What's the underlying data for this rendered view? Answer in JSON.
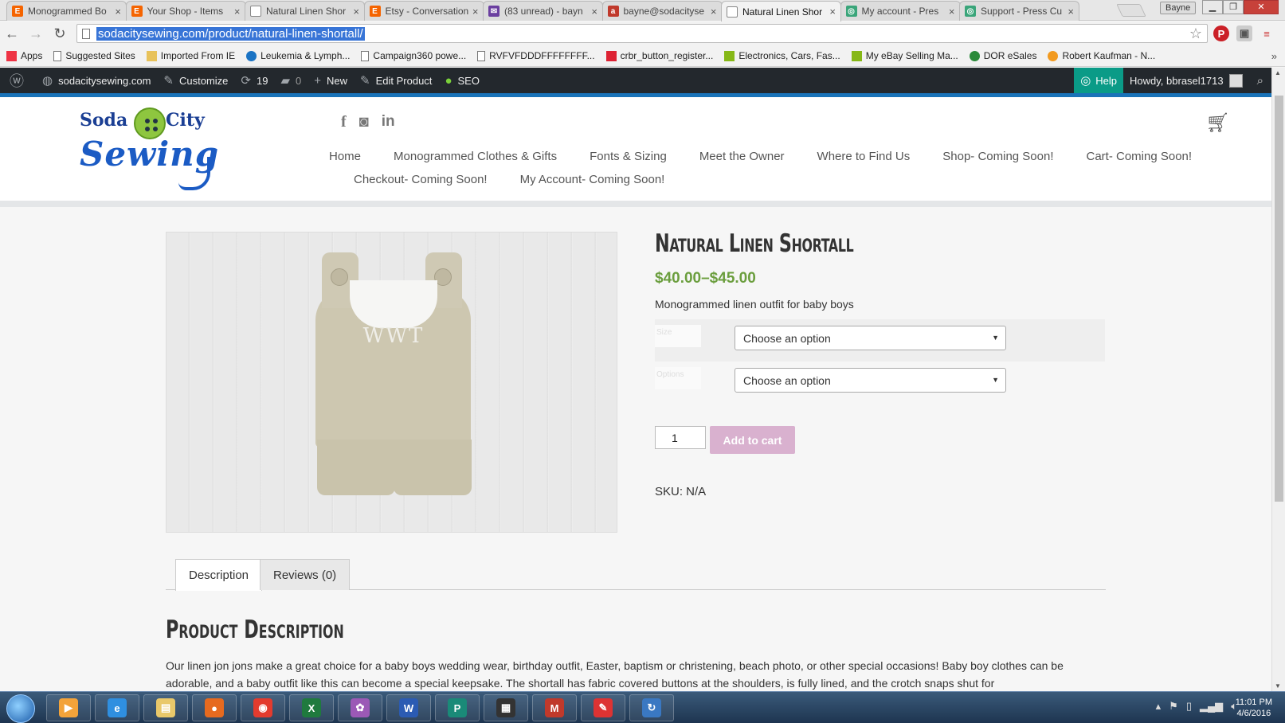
{
  "browser": {
    "tabs": [
      {
        "title": "Monogrammed Bo",
        "icon": "etsy-icon",
        "color": "#f56400",
        "letter": "E"
      },
      {
        "title": "Your Shop - Items",
        "icon": "etsy-icon",
        "color": "#f56400",
        "letter": "E"
      },
      {
        "title": "Natural Linen Shor",
        "icon": "page-icon",
        "color": "#ffffff",
        "letter": ""
      },
      {
        "title": "Etsy - Conversation",
        "icon": "etsy-icon",
        "color": "#f56400",
        "letter": "E"
      },
      {
        "title": "(83 unread) - bayn",
        "icon": "mail-icon",
        "color": "#6b3fa0",
        "letter": "✉"
      },
      {
        "title": "bayne@sodacityse",
        "icon": "mail-icon",
        "color": "#c0392b",
        "letter": "a"
      },
      {
        "title": "Natural Linen Shor",
        "icon": "page-icon",
        "color": "#ffffff",
        "letter": "",
        "active": true
      },
      {
        "title": "My account - Pres",
        "icon": "presscustomizr-icon",
        "color": "#3aa57a",
        "letter": "◎"
      },
      {
        "title": "Support - Press Cu",
        "icon": "presscustomizr-icon",
        "color": "#3aa57a",
        "letter": "◎"
      }
    ],
    "tab_close": "×",
    "profile_name": "Bayne",
    "url": "sodacitysewing.com/product/natural-linen-shortall/",
    "bookmarks": [
      {
        "label": "Apps",
        "icon": "apps-grid-icon",
        "color": "#e34"
      },
      {
        "label": "Suggested Sites",
        "icon": "page-icon",
        "color": "#fff"
      },
      {
        "label": "Imported From IE",
        "icon": "folder-icon",
        "color": "#e8c25a"
      },
      {
        "label": "Leukemia & Lymph...",
        "icon": "lls-icon",
        "color": "#1a73c4"
      },
      {
        "label": "Campaign360 powe...",
        "icon": "page-icon",
        "color": "#fff"
      },
      {
        "label": "RVFVFDDDFFFFFFFF...",
        "icon": "page-icon",
        "color": "#fff"
      },
      {
        "label": "crbr_button_register...",
        "icon": "amex-icon",
        "color": "#d23"
      },
      {
        "label": "Electronics, Cars, Fas...",
        "icon": "ebay-icon",
        "color": "#86b817"
      },
      {
        "label": "My eBay Selling Ma...",
        "icon": "ebay-icon",
        "color": "#86b817"
      },
      {
        "label": "DOR eSales",
        "icon": "dor-icon",
        "color": "#2a8a3a"
      },
      {
        "label": "Robert Kaufman - N...",
        "icon": "rk-icon",
        "color": "#f29a1f"
      }
    ],
    "bookmarks_more": "»"
  },
  "adminbar": {
    "site": "sodacitysewing.com",
    "customize": "Customize",
    "updates": "19",
    "comments": "0",
    "new": "New",
    "edit_product": "Edit Product",
    "seo": "SEO",
    "help": "Help",
    "howdy": "Howdy, bbrasel1713"
  },
  "site": {
    "logo_top_left": "Soda",
    "logo_top_right": "City",
    "logo_bottom": "Sewing",
    "nav_row1": [
      "Home",
      "Monogrammed Clothes & Gifts",
      "Fonts & Sizing",
      "Meet the Owner",
      "Where to Find Us",
      "Shop- Coming Soon!",
      "Cart- Coming Soon!"
    ],
    "nav_row2": [
      "Checkout- Coming Soon!",
      "My Account- Coming Soon!"
    ]
  },
  "product": {
    "title": "Natural Linen Shortall",
    "price": "$40.00–$45.00",
    "short_description": "Monogrammed linen outfit for baby boys",
    "monogram": "WWT",
    "variations": [
      {
        "label": "Size",
        "placeholder": "Choose an option"
      },
      {
        "label": "Options",
        "placeholder": "Choose an option"
      }
    ],
    "quantity": "1",
    "add_to_cart": "Add to cart",
    "sku": "SKU: N/A",
    "tabs": [
      {
        "label": "Description",
        "active": true
      },
      {
        "label": "Reviews (0)",
        "active": false
      }
    ],
    "description_heading": "Product Description",
    "description": "Our linen jon jons make a great choice for a baby boys wedding wear, birthday outfit, Easter, baptism or christening, beach photo, or other special occasions!  Baby boy clothes can be adorable, and a baby outfit like this can become a special keepsake.  The shortall has fabric covered buttons at the shoulders, is fully lined, and the crotch snaps shut for"
  },
  "taskbar": {
    "items": [
      {
        "name": "media-player-icon",
        "color": "#f3a33a",
        "glyph": "▶"
      },
      {
        "name": "internet-explorer-icon",
        "color": "#2f8fe0",
        "glyph": "e"
      },
      {
        "name": "file-explorer-icon",
        "color": "#e9c86a",
        "glyph": "▤"
      },
      {
        "name": "firefox-icon",
        "color": "#e66a1f",
        "glyph": "●"
      },
      {
        "name": "chrome-icon",
        "color": "#e33b2e",
        "glyph": "◉"
      },
      {
        "name": "excel-icon",
        "color": "#1f7a3e",
        "glyph": "X"
      },
      {
        "name": "flower-app-icon",
        "color": "#9b59b6",
        "glyph": "✿"
      },
      {
        "name": "word-icon",
        "color": "#2b5bb3",
        "glyph": "W"
      },
      {
        "name": "publisher-icon",
        "color": "#1a8a78",
        "glyph": "P"
      },
      {
        "name": "media-center-icon",
        "color": "#333",
        "glyph": "▦"
      },
      {
        "name": "mcafee-icon",
        "color": "#c0392b",
        "glyph": "M"
      },
      {
        "name": "pdf-icon",
        "color": "#d33",
        "glyph": "✎"
      },
      {
        "name": "sync-icon",
        "color": "#3a78c2",
        "glyph": "↻"
      }
    ],
    "time": "11:01 PM",
    "date": "4/6/2016"
  },
  "colors": {
    "price_green": "#6b9e3e",
    "add_to_cart_pink": "#d9b1cf",
    "admin_bar": "#23282d",
    "help_teal": "#0a9b87",
    "header_blue": "#1a73b8"
  }
}
